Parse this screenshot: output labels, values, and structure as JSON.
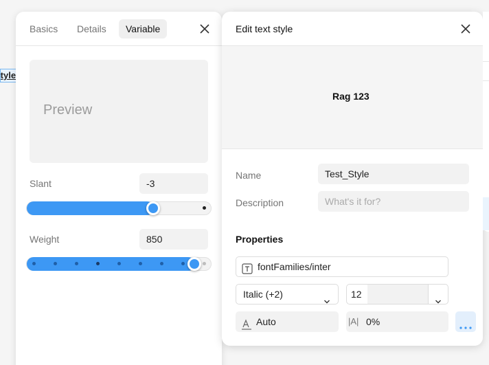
{
  "background": {
    "label": "Style name"
  },
  "left_panel": {
    "tabs": [
      {
        "label": "Basics"
      },
      {
        "label": "Details"
      },
      {
        "label": "Variable"
      }
    ],
    "active_tab": "Variable",
    "preview_text": "Preview",
    "slant": {
      "label": "Slant",
      "value": "-3",
      "position_fraction": 0.7
    },
    "weight": {
      "label": "Weight",
      "value": "850",
      "position_fraction": 0.94,
      "steps": 9
    }
  },
  "right_panel": {
    "title": "Edit text style",
    "preview_text": "Rag 123",
    "name": {
      "label": "Name",
      "value": "Test_Style"
    },
    "description": {
      "label": "Description",
      "placeholder": "What's it for?"
    },
    "properties": {
      "title": "Properties",
      "font_family": "fontFamilies/inter",
      "font_style": "Italic (+2)",
      "font_size": "12",
      "line_height": "Auto",
      "letter_spacing": "0%"
    }
  },
  "colors": {
    "accent": "#3d98f4",
    "accent_light": "#e3effc"
  }
}
